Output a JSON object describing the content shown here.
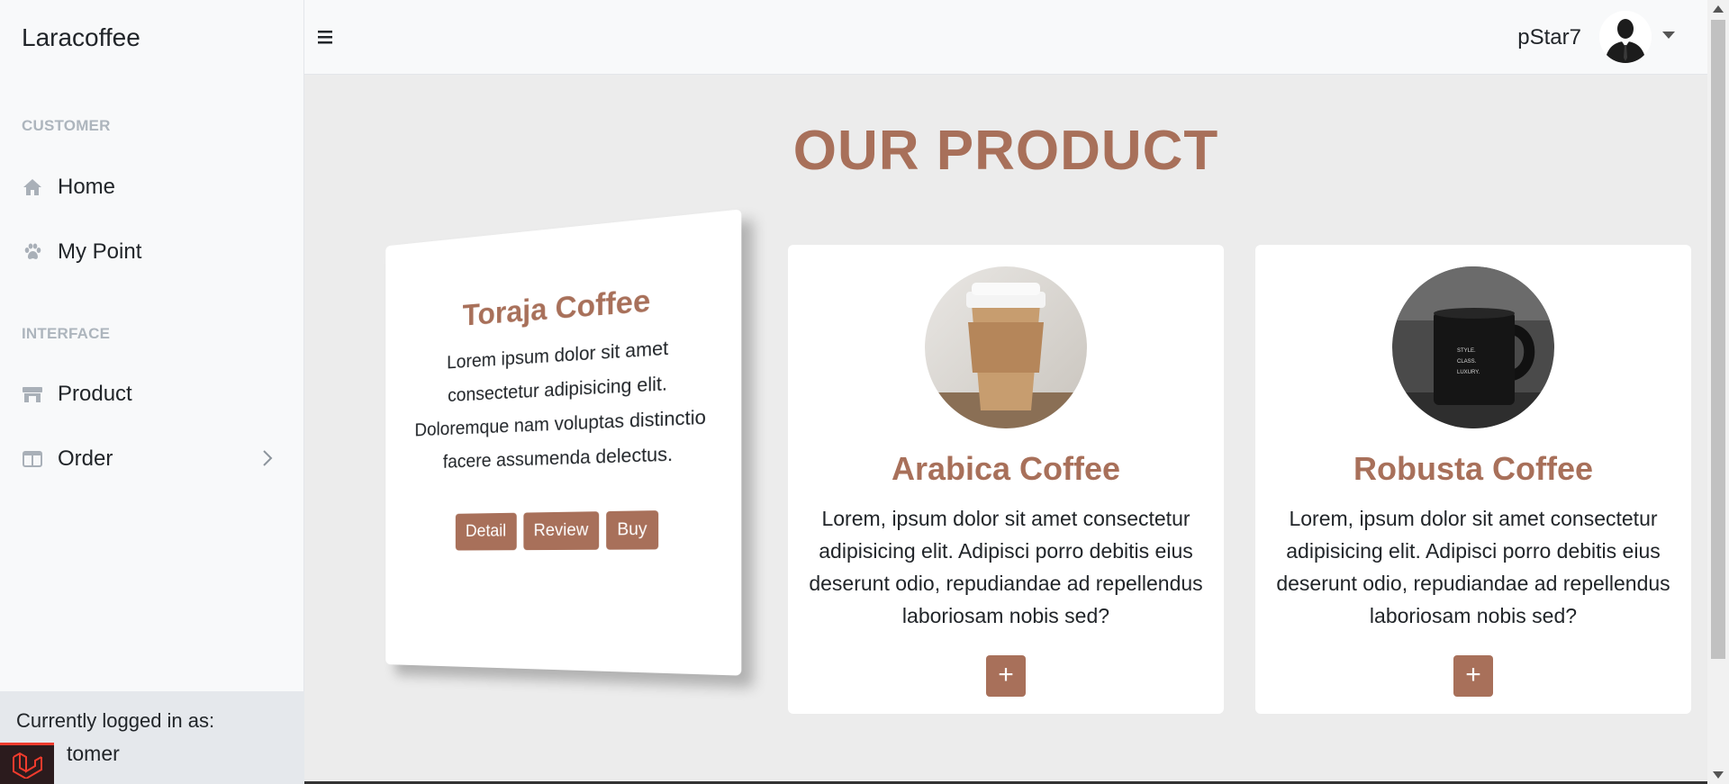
{
  "app": {
    "brand": "Laracoffee"
  },
  "sidebar": {
    "sections": [
      {
        "heading": "CUSTOMER"
      },
      {
        "heading": "INTERFACE"
      }
    ],
    "items": [
      {
        "label": "Home",
        "icon": "home-icon"
      },
      {
        "label": "My Point",
        "icon": "paw-icon"
      },
      {
        "label": "Product",
        "icon": "store-icon"
      },
      {
        "label": "Order",
        "icon": "columns-icon"
      }
    ],
    "footer": {
      "label": "Currently logged in as:",
      "value": "tomer"
    }
  },
  "topbar": {
    "username": "pStar7"
  },
  "main": {
    "title": "OUR PRODUCT",
    "featured": {
      "title": "Toraja Coffee",
      "description": "Lorem ipsum dolor sit amet consectetur adipisicing elit. Doloremque nam voluptas distinctio facere assumenda delectus.",
      "buttons": [
        "Detail",
        "Review",
        "Buy"
      ]
    },
    "products": [
      {
        "title": "Arabica Coffee",
        "description": "Lorem, ipsum dolor sit amet consectetur adipisicing elit. Adipisci porro debitis eius deserunt odio, repudiandae ad repellendus laboriosam nobis sed?",
        "button": "+"
      },
      {
        "title": "Robusta Coffee",
        "description": "Lorem, ipsum dolor sit amet consectetur adipisicing elit. Adipisci porro debitis eius deserunt odio, repudiandae ad repellendus laboriosam nobis sed?",
        "button": "+",
        "mug_text": "STYLE. CLASS. LUXURY."
      }
    ]
  },
  "colors": {
    "accent": "#a8705a",
    "sidebar_bg": "#f8f9fa",
    "main_bg": "#ececec"
  }
}
